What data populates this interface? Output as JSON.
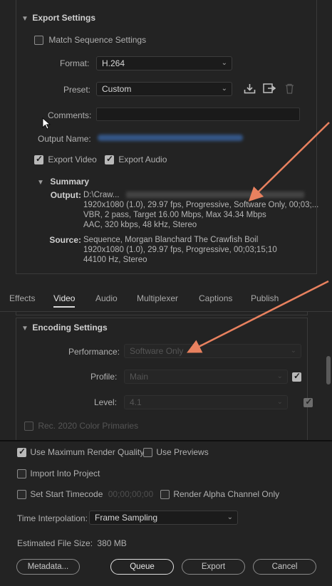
{
  "export_settings": {
    "title": "Export Settings",
    "match_sequence": "Match Sequence Settings",
    "format_label": "Format:",
    "format_value": "H.264",
    "preset_label": "Preset:",
    "preset_value": "Custom",
    "comments_label": "Comments:",
    "comments_value": "",
    "output_name_label": "Output Name:",
    "export_video": "Export Video",
    "export_audio": "Export Audio"
  },
  "summary": {
    "title": "Summary",
    "output_label": "Output:",
    "output_path": "D:\\Craw...",
    "output_lines": [
      "1920x1080 (1.0), 29.97 fps, Progressive, Software Only, 00;03;...",
      "VBR, 2 pass, Target 16.00 Mbps, Max 34.34 Mbps",
      "AAC, 320 kbps, 48 kHz, Stereo"
    ],
    "source_label": "Source:",
    "source_lines": [
      "Sequence, Morgan Blanchard The Crawfish Boil",
      "1920x1080 (1.0), 29.97 fps, Progressive, 00;03;15;10",
      "44100 Hz, Stereo"
    ]
  },
  "tabs": [
    "Effects",
    "Video",
    "Audio",
    "Multiplexer",
    "Captions",
    "Publish"
  ],
  "encoding": {
    "title": "Encoding Settings",
    "performance_label": "Performance:",
    "performance_value": "Software Only",
    "profile_label": "Profile:",
    "profile_value": "Main",
    "level_label": "Level:",
    "level_value": "4.1",
    "rec2020": "Rec. 2020 Color Primaries"
  },
  "bottom": {
    "max_render": "Use Maximum Render Quality",
    "use_previews": "Use Previews",
    "import_project": "Import Into Project",
    "set_start_tc": "Set Start Timecode",
    "timecode_value": "00;00;00;00",
    "render_alpha": "Render Alpha Channel Only",
    "time_interp_label": "Time Interpolation:",
    "time_interp_value": "Frame Sampling",
    "file_size_label": "Estimated File Size:",
    "file_size_value": "380 MB",
    "metadata_btn": "Metadata...",
    "queue_btn": "Queue",
    "export_btn": "Export",
    "cancel_btn": "Cancel"
  },
  "colors": {
    "background": "#232323",
    "annotation_arrow": "#e8815f"
  }
}
